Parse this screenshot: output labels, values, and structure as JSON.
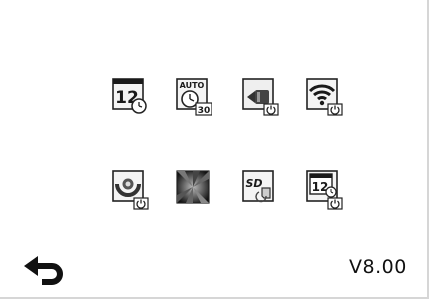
{
  "settings_menu": {
    "row1": [
      {
        "icon": "date-calendar-icon",
        "label_text": "12"
      },
      {
        "icon": "auto-power-off-timer-icon",
        "top_text": "AUTO",
        "badge_text": "30"
      },
      {
        "icon": "flashlight-power-icon"
      },
      {
        "icon": "wifi-power-icon"
      }
    ],
    "row2": [
      {
        "icon": "rotate-image-power-icon"
      },
      {
        "icon": "brightness-contrast-icon"
      },
      {
        "icon": "sd-card-format-icon",
        "label_text": "SD"
      },
      {
        "icon": "date-time-power-icon",
        "label_text": "12"
      }
    ]
  },
  "footer": {
    "back_icon": "return-arrow-icon",
    "version": "V8.00"
  }
}
